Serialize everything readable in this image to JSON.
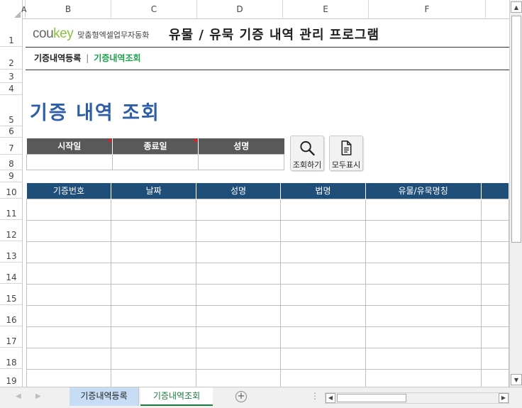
{
  "columns": [
    "A",
    "B",
    "C",
    "D",
    "E",
    "F"
  ],
  "rows": [
    "1",
    "2",
    "3",
    "4",
    "5",
    "6",
    "7",
    "8",
    "9",
    "10",
    "11",
    "12",
    "13",
    "14",
    "15",
    "16",
    "17",
    "18",
    "19"
  ],
  "header": {
    "logo_cou": "cou",
    "logo_key": "key",
    "logo_sub": "맞춤형엑셀업무자동화",
    "program_title": "유물 / 유묵 기증 내역 관리 프로그램"
  },
  "nav": {
    "link_register": "기증내역등록",
    "separator": "|",
    "link_search": "기증내역조회"
  },
  "page_title": "기증 내역 조회",
  "search": {
    "headers": [
      "시작일",
      "종료일",
      "성명"
    ],
    "start_value": "",
    "end_value": "",
    "name_value": ""
  },
  "buttons": {
    "search_label": "조회하기",
    "show_all_label": "모두표시"
  },
  "table": {
    "headers": [
      "기증번호",
      "날짜",
      "성명",
      "법명",
      "유물/유묵명칭"
    ]
  },
  "sheet_tabs": [
    "기증내역등록",
    "기증내역조회"
  ],
  "active_tab": "기증내역조회",
  "colors": {
    "accent_green": "#8ac13f",
    "nav_green": "#1aa24a",
    "title_blue": "#2e5ea8",
    "table_header": "#1f4e79",
    "search_header": "#595959"
  }
}
